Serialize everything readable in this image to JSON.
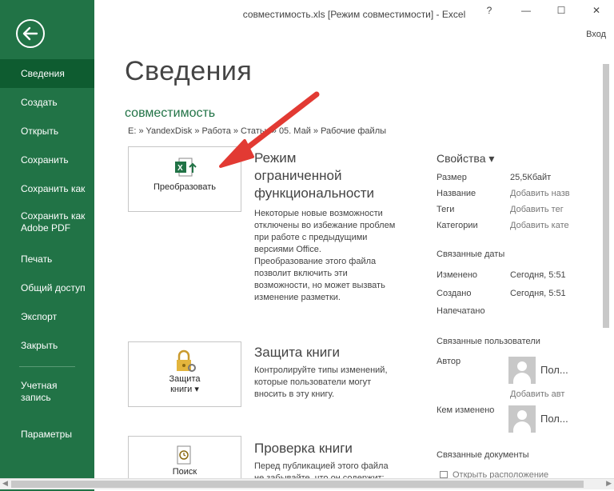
{
  "window": {
    "title": "совместимость.xls  [Режим совместимости] - Excel",
    "help": "?",
    "minimize": "—",
    "maximize": "☐",
    "close": "✕",
    "login": "Вход"
  },
  "sidebar": {
    "back_icon": "arrow-left-icon",
    "items": [
      {
        "label": "Сведения"
      },
      {
        "label": "Создать"
      },
      {
        "label": "Открыть"
      },
      {
        "label": "Сохранить"
      },
      {
        "label": "Сохранить как"
      },
      {
        "label": "Сохранить как",
        "label2": "Adobe PDF"
      },
      {
        "label": "Печать"
      },
      {
        "label": "Общий доступ"
      },
      {
        "label": "Экспорт"
      },
      {
        "label": "Закрыть"
      },
      {
        "label": "Учетная",
        "label2": "запись"
      },
      {
        "label": "Параметры"
      }
    ],
    "accent": "#217346",
    "active": "#0e5c30"
  },
  "main": {
    "title": "Сведения",
    "file_name": "совместимость",
    "path": "E: » YandexDisk » Работа » Статьи » 05. Май » Рабочие файлы",
    "convert": {
      "button": "Преобразовать",
      "title_1": "Режим",
      "title_2": "ограниченной",
      "title_3": "функциональности",
      "desc_1": "Некоторые новые возможности отключены во избежание проблем при работе с предыдущими версиями Office.",
      "desc_2": "Преобразование этого файла позволит включить эти возможности, но может вызвать изменение разметки."
    },
    "protect": {
      "button_1": "Защита",
      "button_2": "книги ▾",
      "title": "Защита книги",
      "desc": "Контролируйте типы изменений, которые пользователи могут вносить в эту книгу."
    },
    "check": {
      "button": "Поиск",
      "title": "Проверка книги",
      "desc": "Перед публикацией этого файла не забывайте, что он содержит:"
    }
  },
  "properties": {
    "header": "Свойства ▾",
    "rows": [
      {
        "label": "Размер",
        "value": "25,5Кбайт"
      },
      {
        "label": "Название",
        "value": "Добавить назв"
      },
      {
        "label": "Теги",
        "value": "Добавить тег"
      },
      {
        "label": "Категории",
        "value": "Добавить кате"
      }
    ],
    "dates_header": "Связанные даты",
    "dates": [
      {
        "label": "Изменено",
        "value": "Сегодня, 5:51"
      },
      {
        "label": "Создано",
        "value": "Сегодня, 5:51"
      },
      {
        "label": "Напечатано",
        "value": ""
      }
    ],
    "people_header": "Связанные пользователи",
    "author_label": "Автор",
    "author_name": "Пол...",
    "add_author": "Добавить авт",
    "modified_by_label": "Кем изменено",
    "modified_by_name": "Пол...",
    "docs_header": "Связанные документы",
    "open_location": "Открыть расположение"
  }
}
